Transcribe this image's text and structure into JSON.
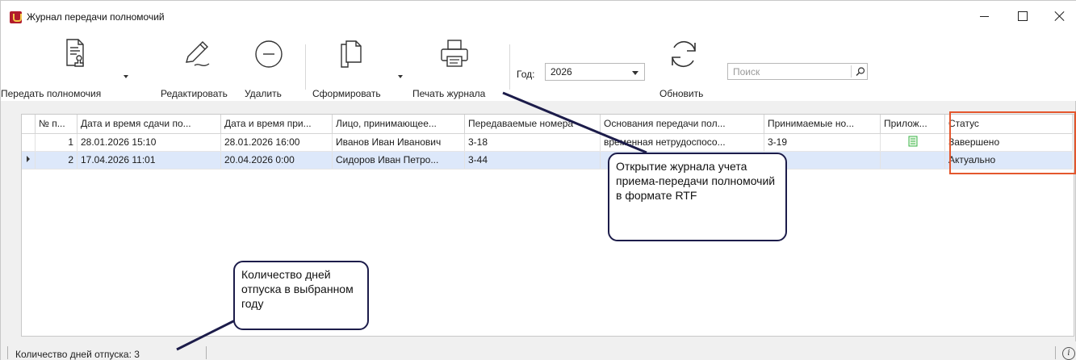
{
  "window": {
    "title": "Журнал передачи полномочий"
  },
  "toolbar": {
    "transfer_label": "Передать полномочия",
    "edit_label": "Редактировать",
    "delete_label": "Удалить",
    "generate_label": "Сформировать",
    "print_label": "Печать журнала",
    "year_label": "Год:",
    "year_value": "2026",
    "refresh_label": "Обновить",
    "search_placeholder": "Поиск"
  },
  "grid": {
    "columns": [
      "№ п...",
      "Дата и время сдачи по...",
      "Дата и время при...",
      "Лицо, принимающее...",
      "Передаваемые номера",
      "Основания передачи пол...",
      "Принимаемые но...",
      "Прилож...",
      "Статус"
    ],
    "rows": [
      {
        "num": "1",
        "date_out": "28.01.2026 15:10",
        "date_in": "28.01.2026 16:00",
        "person": "Иванов Иван Иванович",
        "numbers": "3-18",
        "reason": "временная нетрудоспосо...",
        "accepted": "3-19",
        "attachment_icon": "document-icon",
        "status": "Завершено"
      },
      {
        "num": "2",
        "date_out": "17.04.2026 11:01",
        "date_in": "20.04.2026 0:00",
        "person": "Сидоров Иван Петро...",
        "numbers": "3-44",
        "reason": "",
        "accepted": "",
        "attachment_icon": "",
        "status": "Актуально"
      }
    ]
  },
  "statusbar": {
    "vacation_days": "Количество дней отпуска: 3"
  },
  "callouts": {
    "print_note": "Открытие журнала учета приема-передачи полномочий в формате RTF",
    "vacation_note": "Количество дней отпуска в выбранном году"
  },
  "colors": {
    "highlight": "#e4572e",
    "selected_row": "#dde8fa",
    "callout_border": "#1c1c4a",
    "attachment_icon": "#3cb44a"
  }
}
